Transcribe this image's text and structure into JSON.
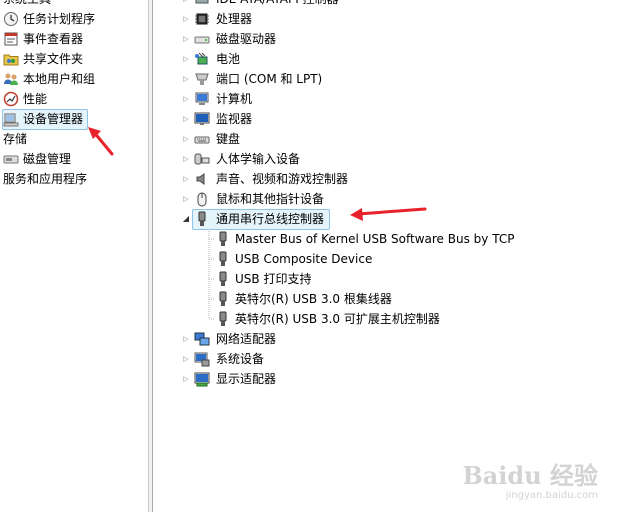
{
  "left_pane": {
    "items": [
      {
        "label": "系统工具",
        "icon": "system-tools-icon"
      },
      {
        "label": "任务计划程序",
        "icon": "clock-icon"
      },
      {
        "label": "事件查看器",
        "icon": "event-viewer-icon"
      },
      {
        "label": "共享文件夹",
        "icon": "shared-folder-icon"
      },
      {
        "label": "本地用户和组",
        "icon": "users-icon"
      },
      {
        "label": "性能",
        "icon": "performance-icon"
      },
      {
        "label": "设备管理器",
        "icon": "device-manager-icon"
      },
      {
        "label": "存储",
        "icon": ""
      },
      {
        "label": "磁盘管理",
        "icon": "disk-management-icon"
      },
      {
        "label": "服务和应用程序",
        "icon": ""
      }
    ]
  },
  "device_tree": {
    "categories": [
      {
        "label": "IDE ATA/ATAPI 控制器",
        "icon": "ide-controller-icon"
      },
      {
        "label": "处理器",
        "icon": "processor-icon"
      },
      {
        "label": "磁盘驱动器",
        "icon": "disk-drive-icon"
      },
      {
        "label": "电池",
        "icon": "battery-icon"
      },
      {
        "label": "端口 (COM 和 LPT)",
        "icon": "port-icon"
      },
      {
        "label": "计算机",
        "icon": "computer-icon"
      },
      {
        "label": "监视器",
        "icon": "monitor-icon"
      },
      {
        "label": "键盘",
        "icon": "keyboard-icon"
      },
      {
        "label": "人体学输入设备",
        "icon": "hid-icon"
      },
      {
        "label": "声音、视频和游戏控制器",
        "icon": "speaker-icon"
      },
      {
        "label": "鼠标和其他指针设备",
        "icon": "mouse-icon"
      },
      {
        "label": "通用串行总线控制器",
        "icon": "usb-icon",
        "expanded": true
      },
      {
        "label": "网络适配器",
        "icon": "network-icon"
      },
      {
        "label": "系统设备",
        "icon": "system-device-icon"
      },
      {
        "label": "显示适配器",
        "icon": "display-adapter-icon"
      }
    ],
    "usb_children": [
      {
        "label": "Master Bus of Kernel USB Software Bus by TCP",
        "icon": "usb-plug-icon"
      },
      {
        "label": "USB Composite Device",
        "icon": "usb-plug-icon"
      },
      {
        "label": "USB 打印支持",
        "icon": "usb-plug-icon"
      },
      {
        "label": "英特尔(R) USB 3.0 根集线器",
        "icon": "usb-plug-icon"
      },
      {
        "label": "英特尔(R) USB 3.0 可扩展主机控制器",
        "icon": "usb-plug-icon"
      }
    ]
  },
  "annotation_color": "#e8222a",
  "watermark": {
    "logo": "Baidu 经验",
    "url": "jingyan.baidu.com"
  }
}
